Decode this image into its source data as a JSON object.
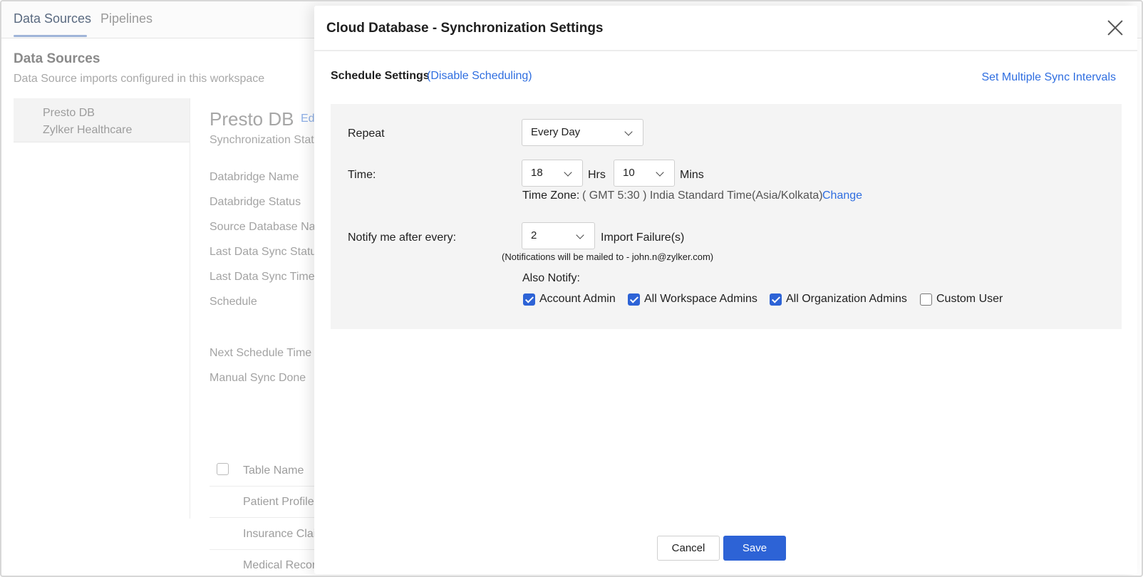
{
  "background": {
    "tabs": [
      {
        "label": "Data Sources",
        "active": true
      },
      {
        "label": "Pipelines",
        "active": false
      }
    ],
    "page_title": "Data Sources",
    "page_subtitle": "Data Source imports configured in this workspace",
    "datasource": {
      "name": "Presto DB",
      "workspace": "Zylker Healthcare"
    },
    "detail": {
      "title": "Presto DB",
      "edit_link": "Ed",
      "subtitle": "Synchronization Stat",
      "fields": [
        "Databridge Name",
        "Databridge Status",
        "Source Database Na",
        "Last Data Sync Statu",
        "Last Data Sync Time",
        "Schedule",
        "Next Schedule Time",
        "Manual Sync Done"
      ]
    },
    "table": {
      "header": "Table Name",
      "rows": [
        "Patient Profile",
        "Insurance Clai",
        "Medical Recor"
      ]
    }
  },
  "modal": {
    "title": "Cloud Database - Synchronization Settings",
    "schedule_title": "Schedule Settings",
    "disable_link": "(Disable Scheduling)",
    "multi_interval_link": "Set Multiple Sync Intervals",
    "repeat": {
      "label": "Repeat",
      "value": "Every Day"
    },
    "time": {
      "label": "Time:",
      "hours": "18",
      "hours_unit": "Hrs",
      "minutes": "10",
      "minutes_unit": "Mins",
      "tz_label": "Time Zone:",
      "tz_value": "( GMT 5:30 ) India Standard Time(Asia/Kolkata)",
      "tz_change": "Change"
    },
    "notify": {
      "label": "Notify me after every:",
      "value": "2",
      "unit": "Import Failure(s)",
      "note": "(Notifications will be mailed to - john.n@zylker.com)",
      "also_label": "Also Notify:",
      "options": [
        {
          "label": "Account Admin",
          "checked": true
        },
        {
          "label": "All Workspace Admins",
          "checked": true
        },
        {
          "label": "All Organization Admins",
          "checked": true
        },
        {
          "label": "Custom User",
          "checked": false
        }
      ]
    },
    "buttons": {
      "cancel": "Cancel",
      "save": "Save"
    }
  },
  "colors": {
    "accent": "#2d63d6",
    "link": "#2f6ee0",
    "panel_bg": "#f4f4f4"
  }
}
